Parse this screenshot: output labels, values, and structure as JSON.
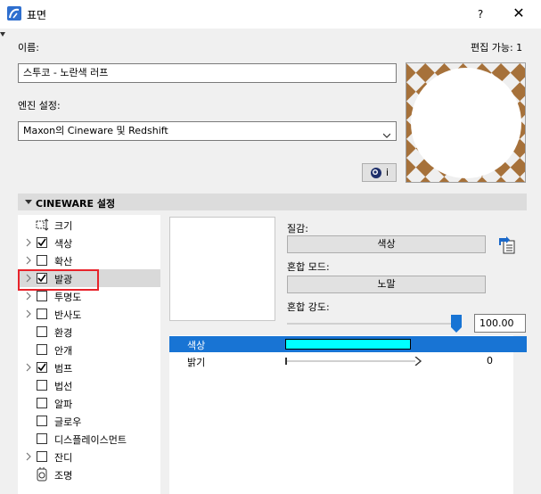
{
  "window": {
    "title": "표면",
    "help": "?",
    "close": "✕"
  },
  "name_field": {
    "label": "이름:",
    "value": "스투코 - 노란색 러프"
  },
  "edit_status": "편집 가능: 1",
  "engine": {
    "label": "엔진 설정:",
    "value": "Maxon의 Cineware 및 Redshift"
  },
  "engine_button": {
    "label": "i"
  },
  "section": {
    "title": "CINEWARE 설정"
  },
  "channels": [
    {
      "label": "크기",
      "expandable": false,
      "type": "icon",
      "checked": false
    },
    {
      "label": "색상",
      "expandable": true,
      "type": "checkbox",
      "checked": true
    },
    {
      "label": "확산",
      "expandable": true,
      "type": "checkbox",
      "checked": false
    },
    {
      "label": "발광",
      "expandable": true,
      "type": "checkbox",
      "checked": true,
      "selected": true
    },
    {
      "label": "투명도",
      "expandable": true,
      "type": "checkbox",
      "checked": false
    },
    {
      "label": "반사도",
      "expandable": true,
      "type": "checkbox",
      "checked": false
    },
    {
      "label": "환경",
      "expandable": false,
      "type": "checkbox",
      "checked": false
    },
    {
      "label": "안개",
      "expandable": false,
      "type": "checkbox",
      "checked": false
    },
    {
      "label": "범프",
      "expandable": true,
      "type": "checkbox",
      "checked": true
    },
    {
      "label": "법선",
      "expandable": false,
      "type": "checkbox",
      "checked": false
    },
    {
      "label": "알파",
      "expandable": false,
      "type": "checkbox",
      "checked": false
    },
    {
      "label": "글로우",
      "expandable": false,
      "type": "checkbox",
      "checked": false
    },
    {
      "label": "디스플레이스먼트",
      "expandable": false,
      "type": "checkbox",
      "checked": false
    },
    {
      "label": "잔디",
      "expandable": true,
      "type": "checkbox",
      "checked": false
    },
    {
      "label": "조명",
      "expandable": false,
      "type": "icon",
      "checked": false
    }
  ],
  "texture": {
    "label": "질감:",
    "value": "색상"
  },
  "blend_mode": {
    "label": "혼합 모드:",
    "value": "노말"
  },
  "blend_strength": {
    "label": "혼합 강도:",
    "value": "100.00",
    "fraction": 1.0
  },
  "params": [
    {
      "label": "색상",
      "color": "#00ffff"
    },
    {
      "label": "밝기",
      "value": "0",
      "fraction": 0.0
    }
  ],
  "colors": {
    "accent": "#1874d4",
    "highlight": "#e8232b",
    "swatch": "#00ffff",
    "preview_floor_a": "#a6713a",
    "preview_floor_b": "#efefef"
  }
}
